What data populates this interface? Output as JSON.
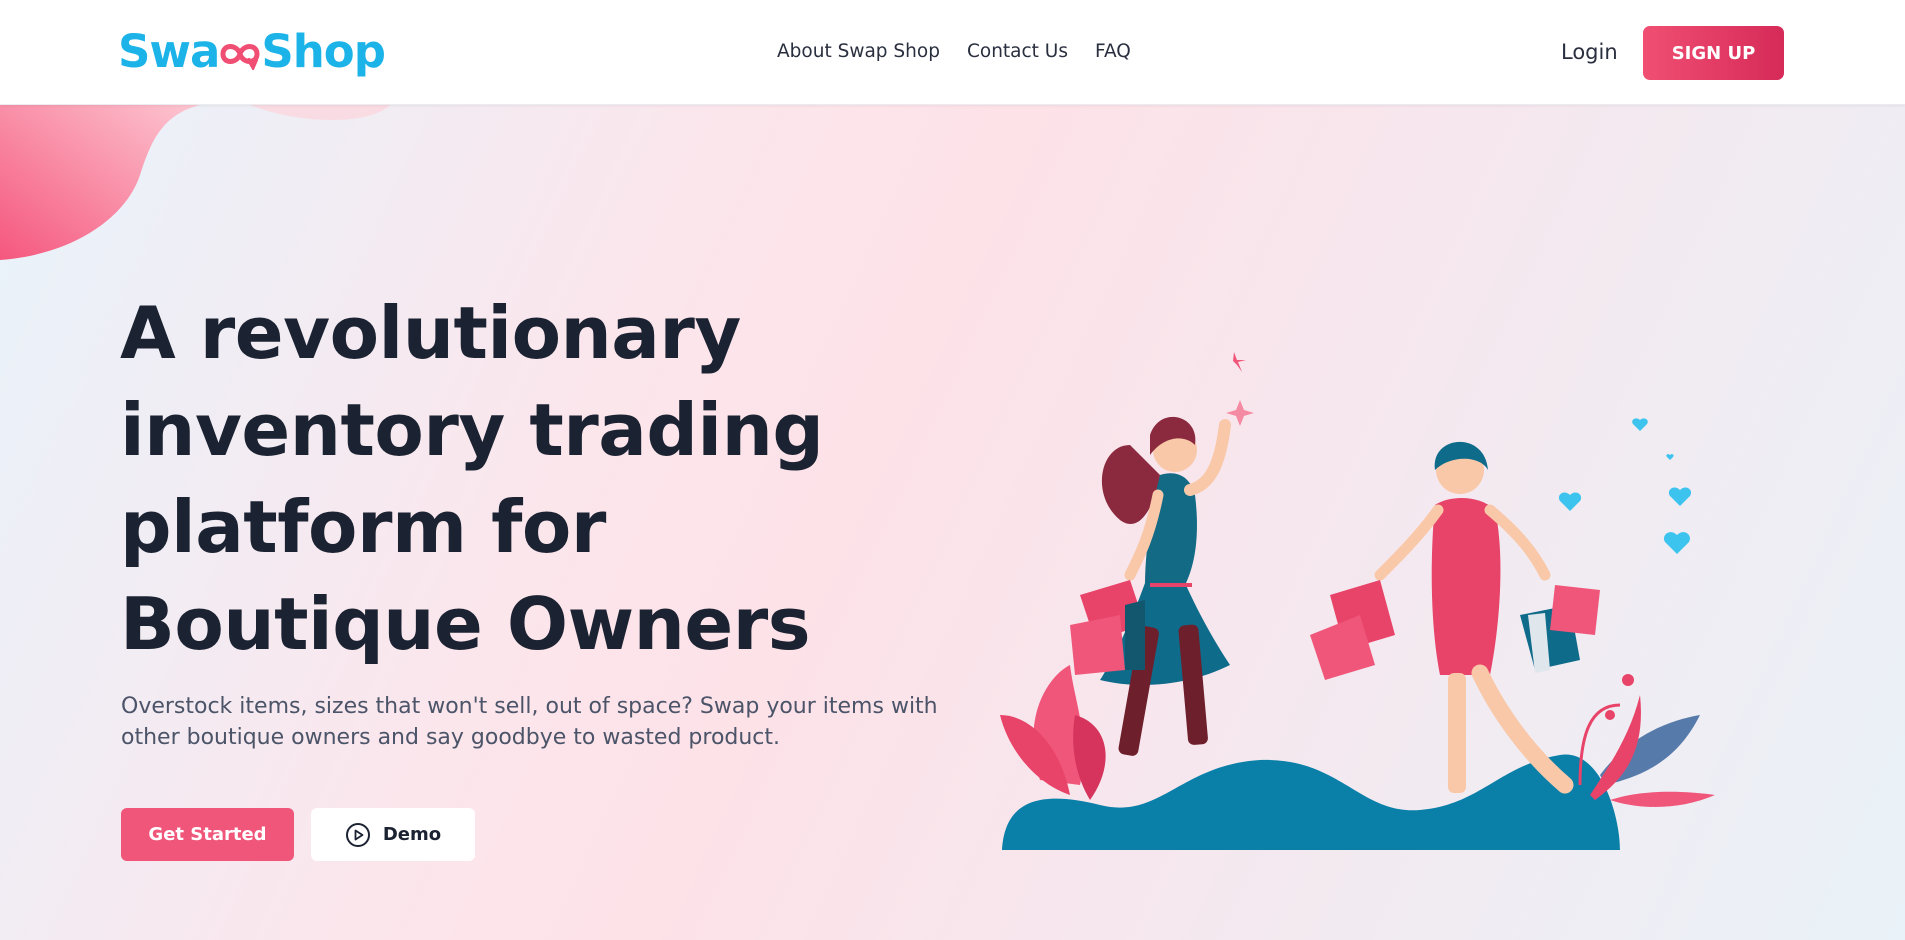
{
  "brand": {
    "logo_part1": "Swa",
    "logo_part2": "Shop",
    "primary_color": "#f0567a",
    "accent_color": "#1cb3e8"
  },
  "nav": {
    "links": [
      {
        "label": "About Swap Shop"
      },
      {
        "label": "Contact Us"
      },
      {
        "label": "FAQ"
      }
    ],
    "login_label": "Login",
    "signup_label": "SIGN UP"
  },
  "hero": {
    "headline_lines": [
      "A revolutionary",
      "inventory trading",
      "platform for",
      "Boutique Owners"
    ],
    "subtext": "Overstock items, sizes that won't sell, out of space? Swap your items with other boutique owners and say goodbye to wasted product.",
    "get_started_label": "Get Started",
    "demo_label": "Demo",
    "demo_icon": "play-circle-icon"
  }
}
